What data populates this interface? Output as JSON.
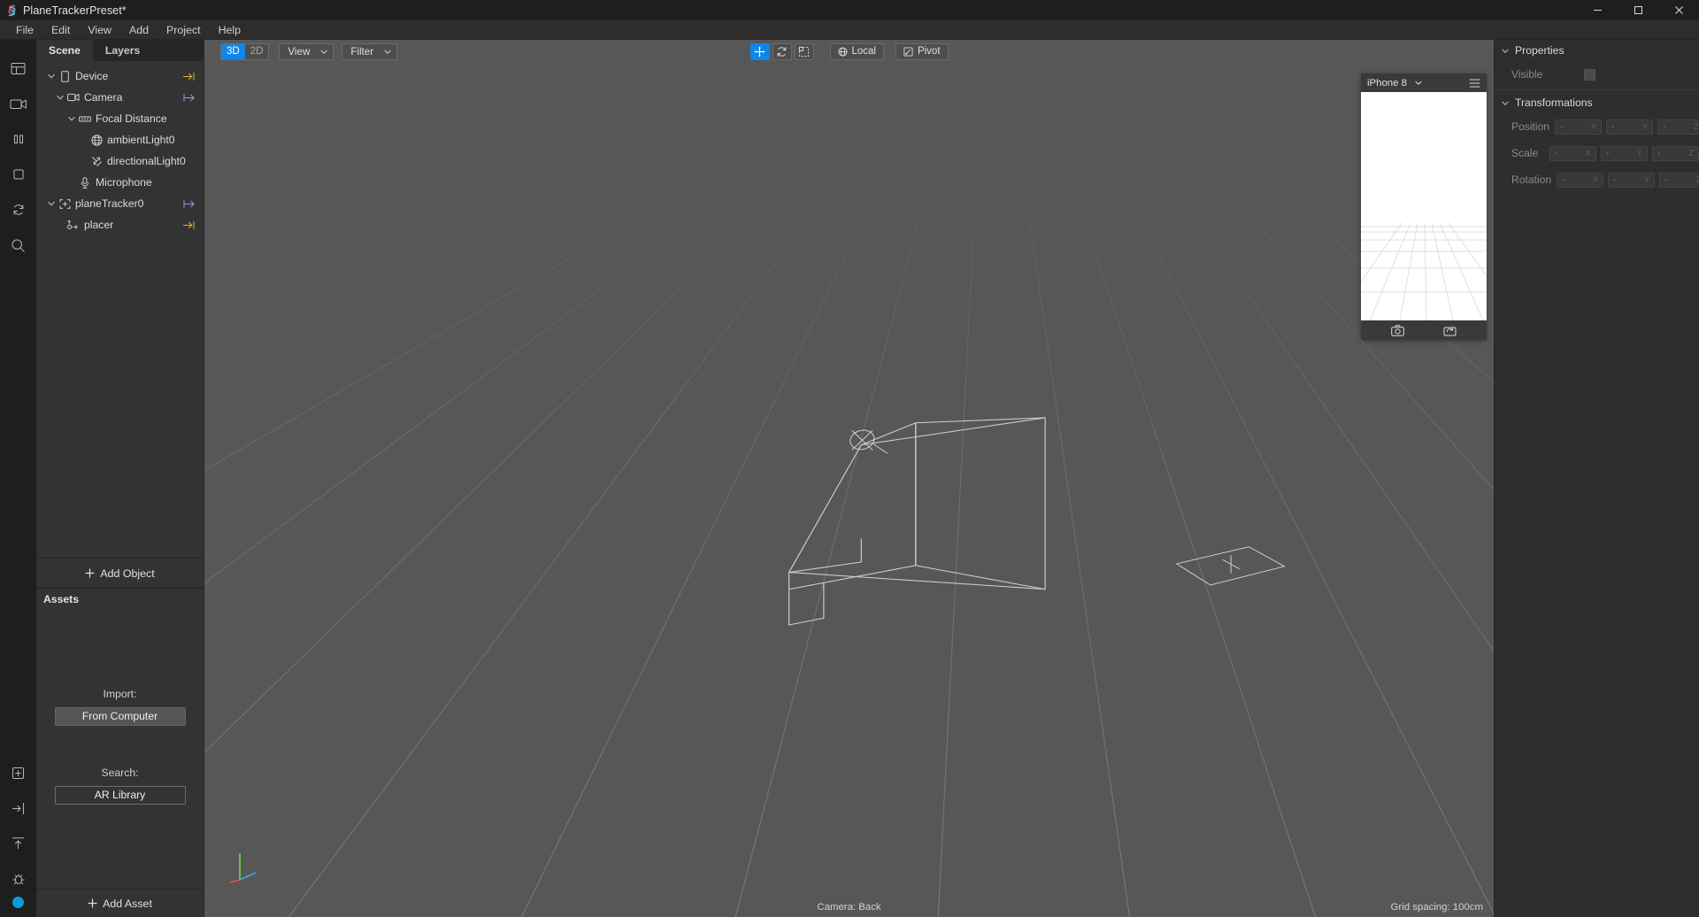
{
  "window": {
    "title": "PlaneTrackerPreset*",
    "app_icon": "spark-ar-logo",
    "minimize": "–",
    "maximize": "□",
    "close": "✕"
  },
  "menubar": {
    "items": [
      {
        "label": "File"
      },
      {
        "label": "Edit"
      },
      {
        "label": "View"
      },
      {
        "label": "Add"
      },
      {
        "label": "Project"
      },
      {
        "label": "Help"
      }
    ]
  },
  "rail": {
    "icons": [
      {
        "name": "layout-icon"
      },
      {
        "name": "video-camera-icon"
      },
      {
        "name": "pause-icon"
      },
      {
        "name": "square-icon"
      },
      {
        "name": "refresh-icon"
      },
      {
        "name": "search-icon"
      },
      {
        "name": "add-patch-icon"
      },
      {
        "name": "import-icon"
      },
      {
        "name": "upload-icon"
      },
      {
        "name": "bug-icon"
      }
    ]
  },
  "left_panel": {
    "tabs": [
      {
        "label": "Scene",
        "active": true
      },
      {
        "label": "Layers",
        "active": false
      }
    ],
    "tree": [
      {
        "label": "Device",
        "indent": 0,
        "icon": "device-icon",
        "twisty": "down",
        "arrow": "yellow"
      },
      {
        "label": "Camera",
        "indent": 1,
        "icon": "camera-icon",
        "twisty": "down",
        "arrow": "purple"
      },
      {
        "label": "Focal Distance",
        "indent": 2,
        "icon": "focal-distance-icon",
        "twisty": "down",
        "arrow": "none"
      },
      {
        "label": "ambientLight0",
        "indent": 3,
        "icon": "ambient-light-icon",
        "twisty": "none",
        "arrow": "none"
      },
      {
        "label": "directionalLight0",
        "indent": 3,
        "icon": "directional-light-icon",
        "twisty": "none",
        "arrow": "none"
      },
      {
        "label": "Microphone",
        "indent": 2,
        "icon": "microphone-icon",
        "twisty": "none",
        "arrow": "none"
      },
      {
        "label": "planeTracker0",
        "indent": 0,
        "icon": "plane-tracker-icon",
        "twisty": "down",
        "arrow": "purple"
      },
      {
        "label": "placer",
        "indent": 1,
        "icon": "placer-icon",
        "twisty": "none",
        "arrow": "yellow"
      }
    ],
    "add_object": {
      "label": "Add Object",
      "icon": "plus-icon"
    },
    "assets": {
      "title": "Assets",
      "import_label": "Import:",
      "import_button": "From Computer",
      "search_label": "Search:",
      "search_button": "AR Library",
      "add_asset": {
        "label": "Add Asset",
        "icon": "plus-icon"
      }
    }
  },
  "viewport": {
    "toolbar": {
      "dimension_toggle": [
        {
          "label": "3D",
          "active": true
        },
        {
          "label": "2D",
          "active": false
        }
      ],
      "view_dropdown": {
        "label": "View",
        "caret": "▾"
      },
      "filter_dropdown": {
        "label": "Filter",
        "caret": "▾"
      },
      "transform_tools": [
        {
          "name": "move-tool",
          "active": true
        },
        {
          "name": "rotate-tool",
          "active": false
        },
        {
          "name": "scale-tool",
          "active": false
        }
      ],
      "space_buttons": [
        {
          "label": "Local",
          "icon": "globe-icon"
        },
        {
          "label": "Pivot",
          "icon": "pivot-icon"
        }
      ]
    },
    "status": {
      "camera": "Camera: Back",
      "grid": "Grid spacing: 100cm"
    },
    "axis_gizmo": {
      "name": "axis-gizmo"
    }
  },
  "device_preview": {
    "device_name": "iPhone 8",
    "caret": "▾",
    "menu_icon": "hamburger-icon",
    "screenshot_icon": "camera-capture-icon",
    "record_icon": "record-loop-icon"
  },
  "properties_panel": {
    "sections": [
      {
        "title": "Properties",
        "caret": "▾",
        "rows": [
          {
            "label": "Visible",
            "type": "checkbox",
            "checked": false
          }
        ]
      },
      {
        "title": "Transformations",
        "caret": "▾",
        "rows": [
          {
            "label": "Position",
            "type": "xyz",
            "values": [
              "-",
              "-",
              "-"
            ],
            "axes": [
              "X",
              "Y",
              "Z"
            ]
          },
          {
            "label": "Scale",
            "type": "xyz",
            "values": [
              "-",
              "-",
              "-"
            ],
            "axes": [
              "X",
              "Y",
              "Z"
            ]
          },
          {
            "label": "Rotation",
            "type": "xyz",
            "values": [
              "-",
              "-",
              "-"
            ],
            "axes": [
              "X",
              "Y",
              "Z"
            ]
          }
        ]
      }
    ]
  },
  "colors": {
    "accent": "#0f87e8",
    "arrow_yellow": "#e8b33a",
    "arrow_purple": "#b78ce8",
    "viewport_bg": "#575757",
    "panel_bg": "#333333",
    "titlebar_bg": "#1e1e1e"
  }
}
